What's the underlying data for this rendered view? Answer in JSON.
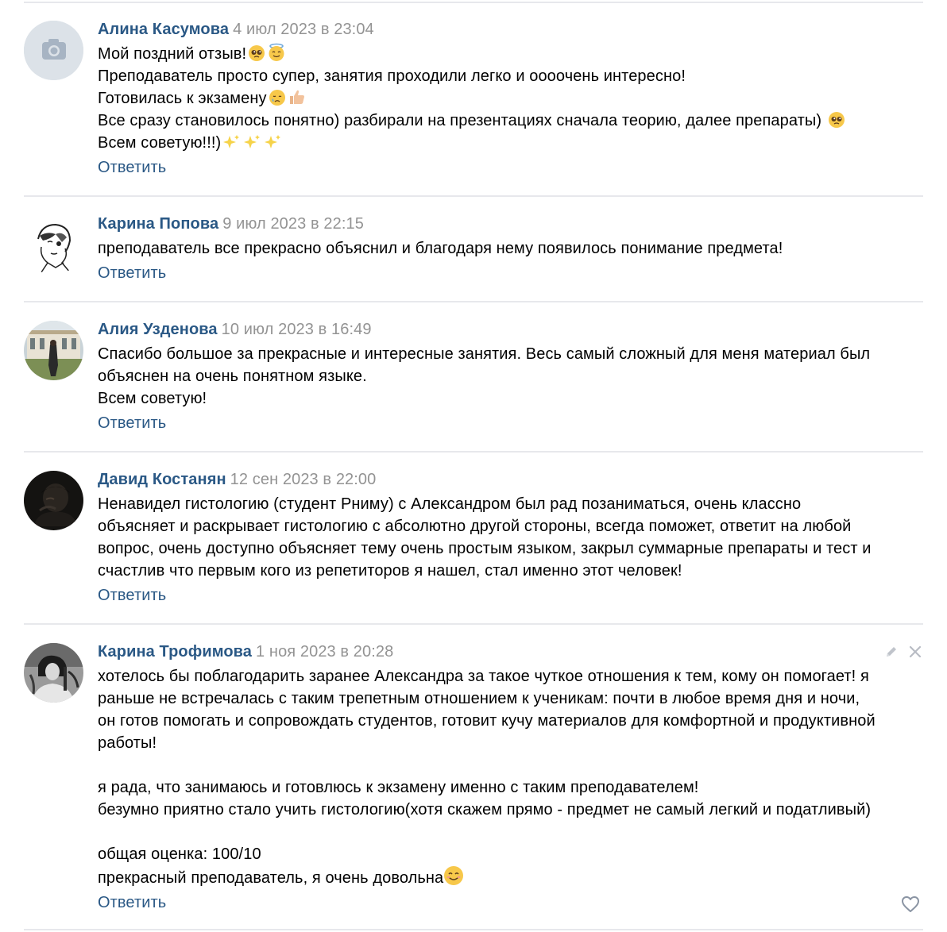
{
  "reply_label": "Ответить",
  "comments": [
    {
      "author": "Алина Касумова",
      "date": "4 июл 2023 в 23:04",
      "avatar_icon": "camera-placeholder-icon",
      "lines": [
        "Мой поздний отзыв!",
        "Преподаватель просто супер, занятия проходили легко и оооочень интересно!",
        "Готовилась к экзамену",
        "Все сразу становилось понятно) разбирали на презентациях сначала теорию, далее препараты) ",
        "Всем советую!!!)"
      ]
    },
    {
      "author": "Карина Попова",
      "date": "9 июл 2023 в 22:15",
      "lines": [
        "преподаватель все прекрасно объяснил и благодаря нему появилось понимание предмета!"
      ]
    },
    {
      "author": "Алия Узденова",
      "date": "10 июл 2023 в 16:49",
      "lines": [
        "Спасибо большое за прекрасные и интересные занятия. Весь самый сложный для меня материал был",
        "объяснен на очень понятном языке.",
        "Всем советую!"
      ]
    },
    {
      "author": "Давид Костанян",
      "date": "12 сен 2023 в 22:00",
      "lines": [
        "Ненавидел гистологию (студент Рниму) с Александром был рад позаниматься, очень классно",
        "объясняет и раскрывает гистологию с абсолютно другой стороны, всегда поможет, ответит на любой",
        "вопрос, очень доступно объясняет тему очень простым языком, закрыл суммарные препараты и тест и",
        "счастлив что первым кого из репетиторов я нашел, стал именно этот человек!"
      ]
    },
    {
      "author": "Карина Трофимова",
      "date": "1 ноя 2023 в 20:28",
      "lines": [
        "хотелось бы поблагодарить заранее Александра за такое чуткое отношения к тем, кому он помогает! я",
        "раньше не встречалась с таким трепетным отношением к ученикам: почти в любое время дня и ночи,",
        "он готов помогать и сопровождать студентов, готовит кучу материалов для комфортной и продуктивной",
        "работы!",
        "",
        "я рада, что занимаюсь и готовлюсь к экзамену именно с таким преподавателем!",
        "безумно приятно стало учить гистологию(хотя скажем прямо - предмет не самый легкий и податливый)",
        "",
        "общая оценка: 100/10",
        "прекрасный преподаватель, я очень довольна"
      ],
      "action_icons": [
        "edit-pencil-icon",
        "delete-x-icon"
      ],
      "like_icon": "heart-outline-icon"
    }
  ],
  "colors": {
    "author_link": "#2a5885",
    "date": "#939393",
    "divider": "#e7e8ec",
    "icon_grey": "#c0c4cb"
  }
}
